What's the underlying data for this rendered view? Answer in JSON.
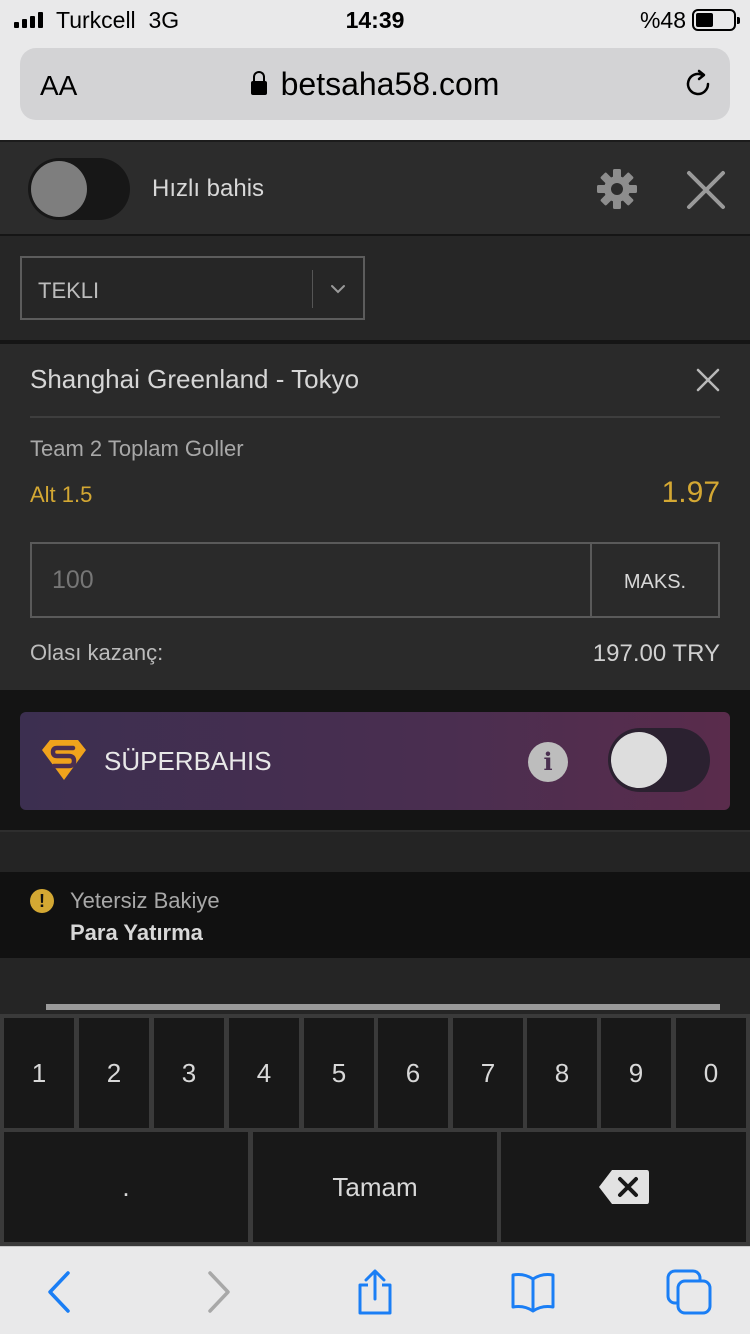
{
  "status_bar": {
    "carrier": "Turkcell",
    "network": "3G",
    "time": "14:39",
    "battery": "%48"
  },
  "browser": {
    "text_size": "AA",
    "url": "betsaha58.com"
  },
  "header": {
    "quick_bet_label": "Hızlı bahis",
    "quick_bet_on": false
  },
  "bet_type": {
    "selected": "TEKLI"
  },
  "selection": {
    "match": "Shanghai Greenland - Tokyo",
    "market": "Team 2 Toplam Goller",
    "pick": "Alt 1.5",
    "odds": "1.97",
    "stake": "100",
    "max_label": "MAKS.",
    "potential_label": "Olası kazanç:",
    "potential_value": "197.00 TRY"
  },
  "superbet": {
    "label": "SÜPERBAHIS",
    "info_symbol": "i",
    "enabled": false
  },
  "balance": {
    "warning_symbol": "!",
    "title": "Yetersiz Bakiye",
    "deposit_label": "Para Yatırma"
  },
  "keypad": {
    "digits": [
      "1",
      "2",
      "3",
      "4",
      "5",
      "6",
      "7",
      "8",
      "9",
      "0"
    ],
    "decimal": ".",
    "done": "Tamam",
    "backspace_icon": "backspace-icon"
  },
  "toolbar": {
    "icons": [
      "back-icon",
      "forward-icon",
      "share-icon",
      "bookmarks-icon",
      "tabs-icon"
    ]
  },
  "colors": {
    "accent_gold": "#d4a833",
    "browser_blue": "#1a7ef5",
    "panel": "#2a2a2a"
  }
}
